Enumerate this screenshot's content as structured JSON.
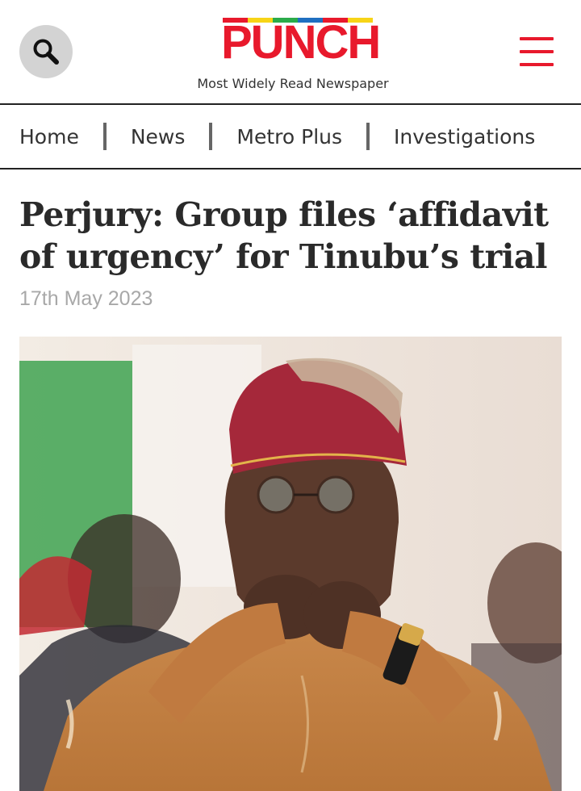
{
  "header": {
    "logo_text": "PUNCH",
    "tagline": "Most Widely Read Newspaper",
    "search_icon": "search-icon",
    "menu_icon": "hamburger-menu-icon",
    "logo_stripe_colors": [
      "#e8192c",
      "#f7d417",
      "#2bab4a",
      "#1f6fc1",
      "#e8192c",
      "#f7d417"
    ]
  },
  "nav": {
    "items": [
      {
        "label": "Home"
      },
      {
        "label": "News"
      },
      {
        "label": "Metro Plus"
      },
      {
        "label": "Investigations"
      }
    ]
  },
  "article": {
    "title": "Perjury: Group files ‘affidavit of urgency’ for Tinubu’s trial",
    "date": "17th May 2023"
  },
  "colors": {
    "brand_red": "#e8192c",
    "headline": "#2a2a2a",
    "date_gray": "#a8a8a8"
  }
}
